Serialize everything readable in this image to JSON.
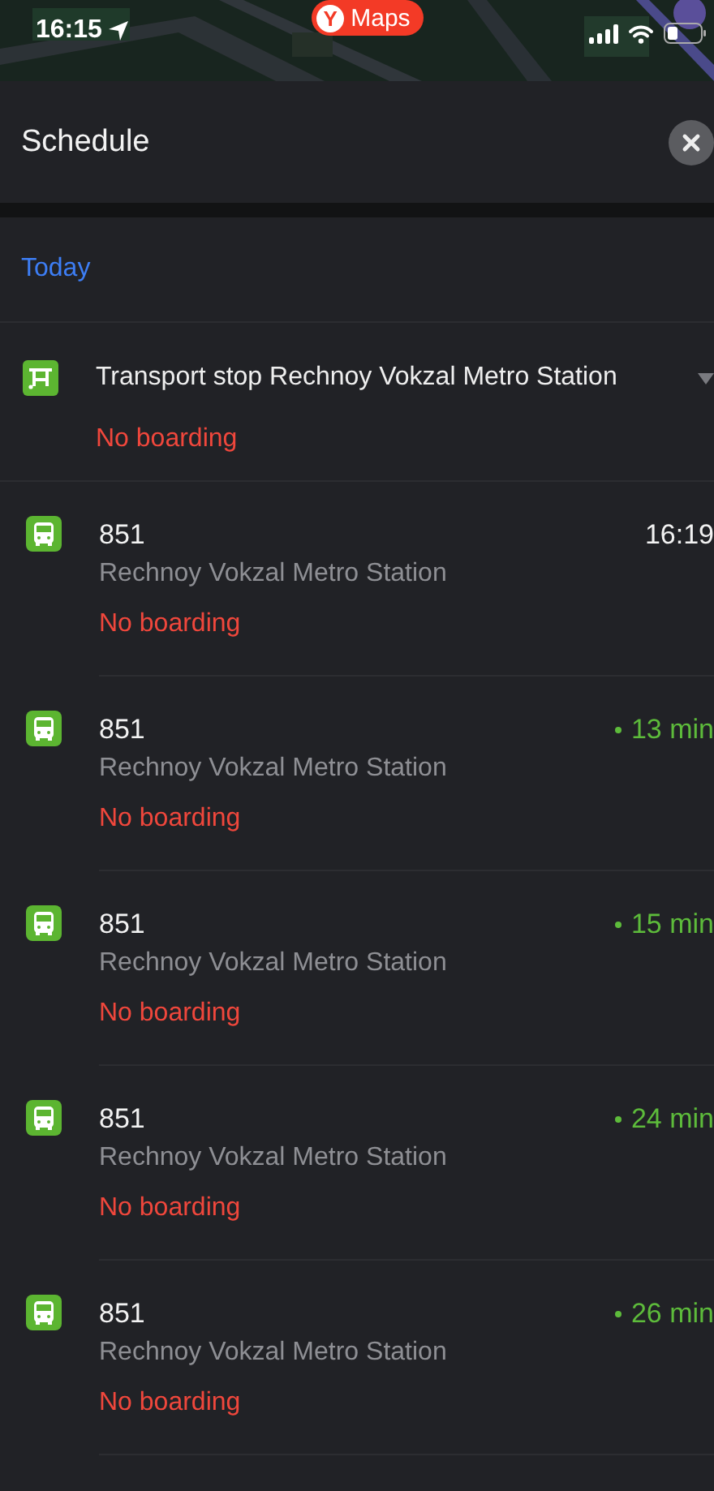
{
  "status_bar": {
    "time": "16:15",
    "app_badge": {
      "logo": "Y",
      "label": "Maps"
    }
  },
  "sheet": {
    "title": "Schedule"
  },
  "day": "Today",
  "stop": {
    "name": "Transport stop Rechnoy Vokzal Metro Station",
    "status": "No boarding"
  },
  "departures": [
    {
      "route": "851",
      "stop": "Rechnoy Vokzal Metro Station",
      "status": "No boarding",
      "kind": "scheduled",
      "time": "16:19"
    },
    {
      "route": "851",
      "stop": "Rechnoy Vokzal Metro Station",
      "status": "No boarding",
      "kind": "live",
      "time": "13 min"
    },
    {
      "route": "851",
      "stop": "Rechnoy Vokzal Metro Station",
      "status": "No boarding",
      "kind": "live",
      "time": "15 min"
    },
    {
      "route": "851",
      "stop": "Rechnoy Vokzal Metro Station",
      "status": "No boarding",
      "kind": "live",
      "time": "24 min"
    },
    {
      "route": "851",
      "stop": "Rechnoy Vokzal Metro Station",
      "status": "No boarding",
      "kind": "live",
      "time": "26 min"
    }
  ]
}
